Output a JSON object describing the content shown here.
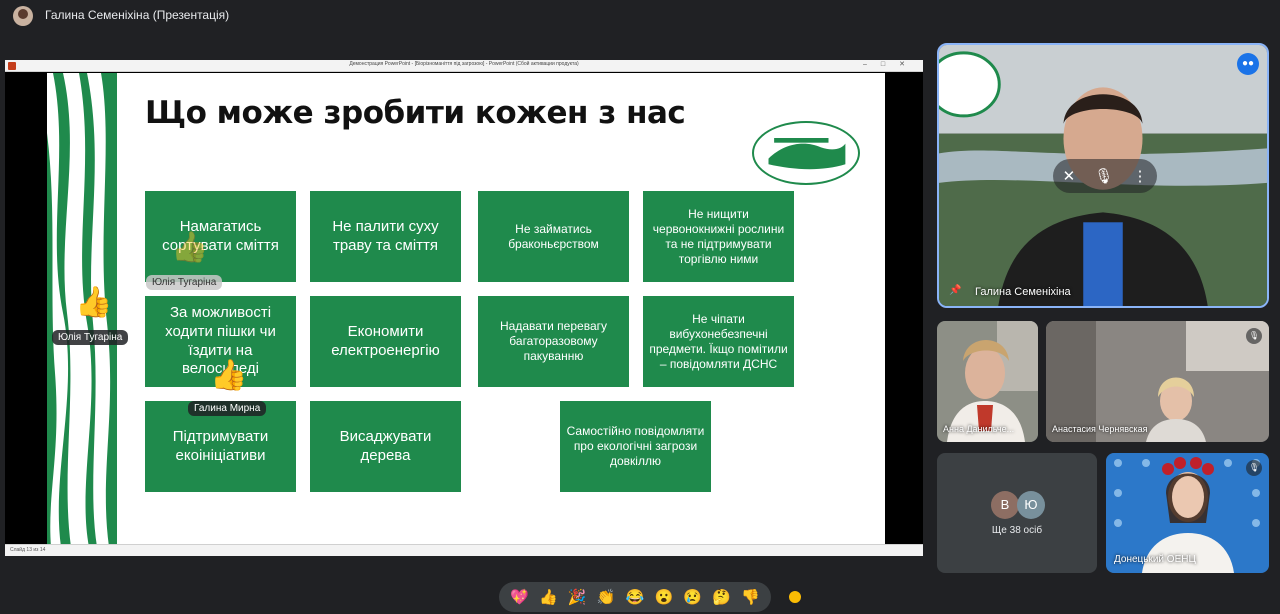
{
  "topbar": {
    "presenter_title": "Галина Семеніхіна (Презентація)"
  },
  "ppt": {
    "window_title": "Демонстрация PowerPoint - [Біорізноманіття під загрозою] - PowerPoint (Сбой активации продукта)",
    "status": "Слайд 13 из 14"
  },
  "slide": {
    "heading": "Що може зробити кожен з нас",
    "tiles": [
      "Намагатись сортувати сміття",
      "Не палити суху траву та сміття",
      "Не займатись браконьєрством",
      "Не нищити червонокнижні рослини та не підтримувати торгівлю ними",
      "За можливості ходити пішки чи їздити на велосипеді",
      "Економити електроенергію",
      "Надавати перевагу багаторазовому пакуванню",
      "Не чіпати вибухонебезпечні предмети. Їкщо помітили – повідомляти ДСНС",
      "Підтримувати екоініціативи",
      "Висаджувати дерева",
      "Самостійно повідомляти про екологічні загрози довкіллю"
    ],
    "name_tags": [
      "Юлія Тугаріна",
      "Юлія Тугаріна",
      "Галина Мирна"
    ]
  },
  "participants": {
    "main": {
      "name": "Галина Семеніхіна"
    },
    "tile2": {
      "name": "Анна Данильче..."
    },
    "tile3": {
      "name": "Анастасия Чернявская"
    },
    "more": {
      "initials": [
        "В",
        "Ю"
      ],
      "label": "Ще 38 осіб"
    },
    "tile5": {
      "name": "Донецький ОЕНЦ"
    }
  },
  "reactions": [
    "💖",
    "👍",
    "🎉",
    "👏",
    "😂",
    "😮",
    "😢",
    "🤔",
    "👎"
  ],
  "colors": {
    "accent_green": "#1f8a4c",
    "meet_bg": "#202124",
    "tile_bg": "#3c4043",
    "active_border": "#8ab4f8"
  }
}
